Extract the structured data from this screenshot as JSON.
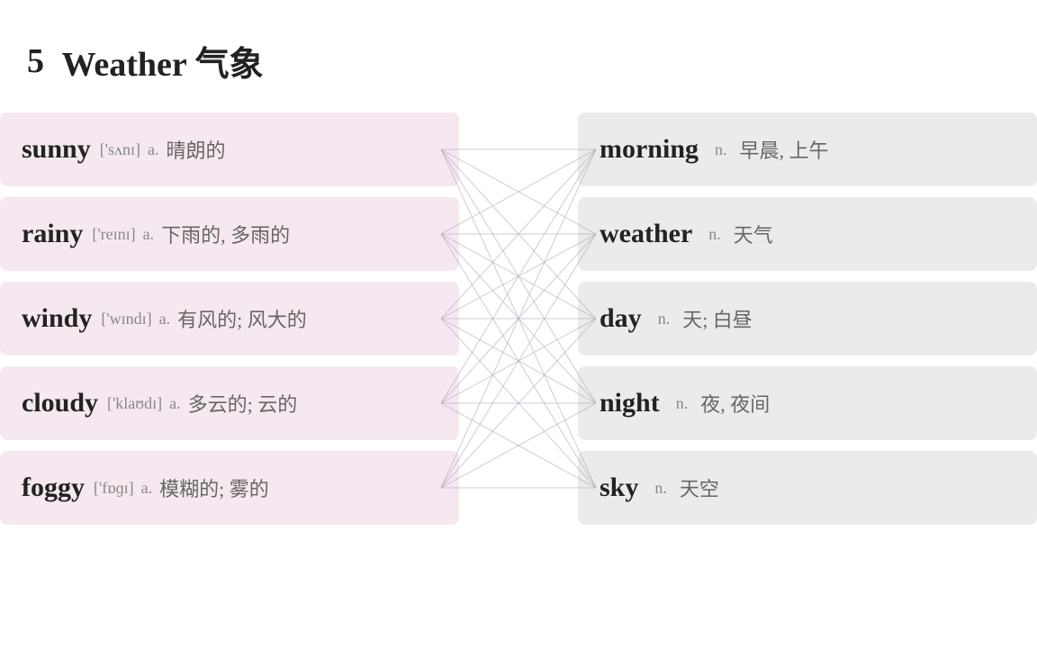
{
  "title": {
    "number": "5",
    "english": "Weather",
    "chinese": "气象"
  },
  "left_words": [
    {
      "word": "sunny",
      "phonetic": "['sʌnɪ]",
      "pos": "a.",
      "translation": "晴朗的"
    },
    {
      "word": "rainy",
      "phonetic": "['reɪnɪ]",
      "pos": "a.",
      "translation": "下雨的, 多雨的"
    },
    {
      "word": "windy",
      "phonetic": "['wɪndɪ]",
      "pos": "a.",
      "translation": "有风的; 风大的"
    },
    {
      "word": "cloudy",
      "phonetic": "['klaʊdɪ]",
      "pos": "a.",
      "translation": "多云的; 云的"
    },
    {
      "word": "foggy",
      "phonetic": "['fɒɡɪ]",
      "pos": "a.",
      "translation": "模糊的; 雾的"
    }
  ],
  "right_words": [
    {
      "word": "morning",
      "pos": "n.",
      "translation": "早晨, 上午"
    },
    {
      "word": "weather",
      "pos": "n.",
      "translation": "天气"
    },
    {
      "word": "day",
      "pos": "n.",
      "translation": "天; 白昼"
    },
    {
      "word": "night",
      "pos": "n.",
      "translation": "夜, 夜间"
    },
    {
      "word": "sky",
      "pos": "n.",
      "translation": "天空"
    }
  ]
}
